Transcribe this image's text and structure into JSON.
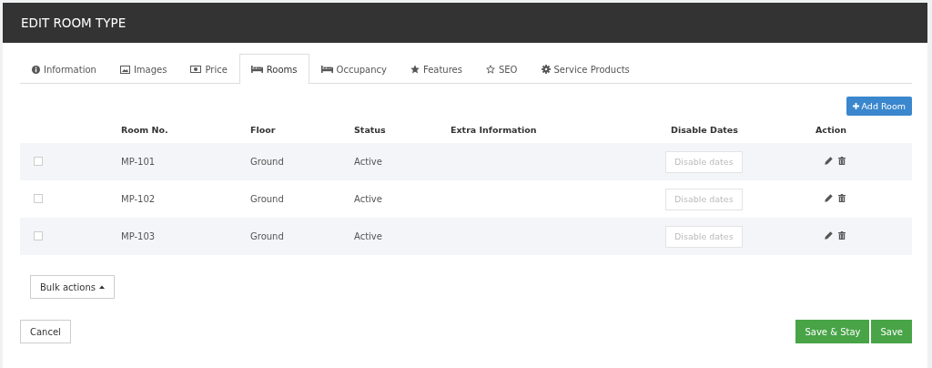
{
  "title": "EDIT ROOM TYPE",
  "tabs": [
    {
      "label": "Information",
      "selected": false
    },
    {
      "label": "Images",
      "selected": false
    },
    {
      "label": "Price",
      "selected": false
    },
    {
      "label": "Rooms",
      "selected": true
    },
    {
      "label": "Occupancy",
      "selected": false
    },
    {
      "label": "Features",
      "selected": false
    },
    {
      "label": "SEO",
      "selected": false
    },
    {
      "label": "Service Products",
      "selected": false
    }
  ],
  "add_button": "Add Room",
  "table": {
    "columns": [
      "Room No.",
      "Floor",
      "Status",
      "Extra Information",
      "Disable Dates",
      "Action"
    ],
    "rows": [
      {
        "checked": false,
        "room": "MP-101",
        "floor": "Ground",
        "status": "Active",
        "dates_button": "Disable dates"
      },
      {
        "checked": false,
        "room": "MP-102",
        "floor": "Ground",
        "status": "Active",
        "dates_button": "Disable dates"
      },
      {
        "checked": false,
        "room": "MP-103",
        "floor": "Ground",
        "status": "Active",
        "dates_button": "Disable dates"
      }
    ]
  },
  "bulk_button": "Bulk actions",
  "cancel_button": "Cancel",
  "save_stay_button": "Save & Stay",
  "save_button": "Save"
}
